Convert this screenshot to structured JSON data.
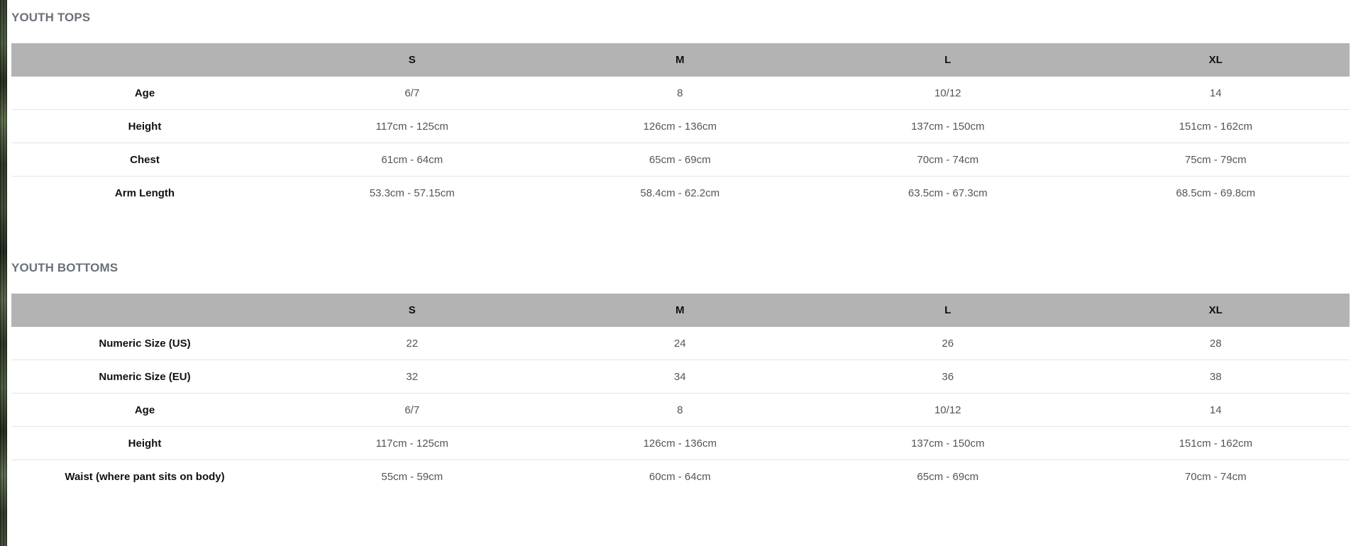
{
  "tops": {
    "title": "YOUTH TOPS",
    "columns": [
      "",
      "S",
      "M",
      "L",
      "XL"
    ],
    "rows": [
      {
        "label": "Age",
        "values": [
          "6/7",
          "8",
          "10/12",
          "14"
        ]
      },
      {
        "label": "Height",
        "values": [
          "117cm - 125cm",
          "126cm - 136cm",
          "137cm - 150cm",
          "151cm - 162cm"
        ]
      },
      {
        "label": "Chest",
        "values": [
          "61cm - 64cm",
          "65cm - 69cm",
          "70cm - 74cm",
          "75cm - 79cm"
        ]
      },
      {
        "label": "Arm Length",
        "values": [
          "53.3cm - 57.15cm",
          "58.4cm - 62.2cm",
          "63.5cm - 67.3cm",
          "68.5cm - 69.8cm"
        ]
      }
    ]
  },
  "bottoms": {
    "title": "YOUTH BOTTOMS",
    "columns": [
      "",
      "S",
      "M",
      "L",
      "XL"
    ],
    "rows": [
      {
        "label": "Numeric Size (US)",
        "values": [
          "22",
          "24",
          "26",
          "28"
        ]
      },
      {
        "label": "Numeric Size (EU)",
        "values": [
          "32",
          "34",
          "36",
          "38"
        ]
      },
      {
        "label": "Age",
        "values": [
          "6/7",
          "8",
          "10/12",
          "14"
        ]
      },
      {
        "label": "Height",
        "values": [
          "117cm - 125cm",
          "126cm - 136cm",
          "137cm - 150cm",
          "151cm - 162cm"
        ]
      },
      {
        "label": "Waist (where pant sits on body)",
        "values": [
          "55cm - 59cm",
          "60cm - 64cm",
          "65cm - 69cm",
          "70cm - 74cm"
        ]
      }
    ]
  },
  "colors": {
    "header_bg": "#b3b3b3",
    "title_text": "#6b7178",
    "label_text": "#111111",
    "value_text": "#555555",
    "row_divider": "#e4e4e4"
  }
}
